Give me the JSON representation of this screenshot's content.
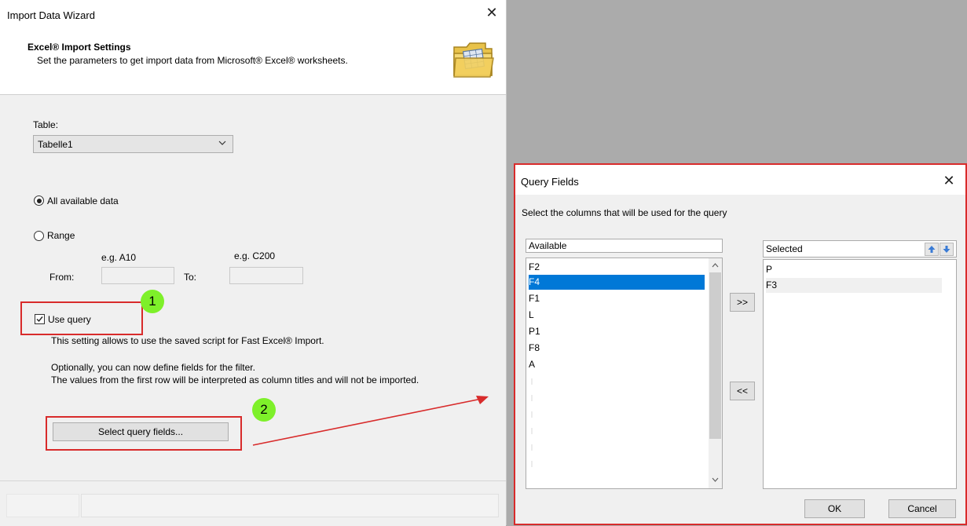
{
  "wizard": {
    "title": "Import Data Wizard",
    "close_glyph": "✕",
    "heading": "Excel® Import Settings",
    "subheading": "Set the parameters to get import data from Microsoft® Excel® worksheets.",
    "header_icon": "folder-spreadsheet-icon",
    "table_label": "Table:",
    "table_value": "Tabelle1",
    "option_all": "All available data",
    "option_range": "Range",
    "range_from_hint": "e.g. A10",
    "range_to_hint": "e.g. C200",
    "range_from_label": "From:",
    "range_to_label": "To:",
    "use_query_label": "Use query",
    "use_query_checked": true,
    "use_query_desc": "This setting allows to use the saved script for Fast Excel® Import.",
    "optional_line1": "Optionally, you can now define fields for the filter.",
    "optional_line2": "The values from the first row will be interpreted as column titles and will not be imported.",
    "select_fields_button": "Select query fields...",
    "selected_option": "All available data"
  },
  "annotations": {
    "badge1": "1",
    "badge2": "2",
    "highlight_color": "#d82b2b",
    "badge_color": "#7ef02a"
  },
  "query_fields": {
    "title": "Query Fields",
    "close_glyph": "✕",
    "description": "Select the columns that will be used for the query",
    "available_header": "Available",
    "selected_header": "Selected",
    "available_items": [
      "F2",
      "F4",
      "F1",
      "L",
      "P1",
      "F8",
      "A"
    ],
    "available_selected": "F4",
    "selected_items": [
      "P",
      "F3"
    ],
    "add_button": ">>",
    "remove_button": "<<",
    "move_up_icon": "arrow-up-icon",
    "move_down_icon": "arrow-down-icon",
    "ok_button": "OK",
    "cancel_button": "Cancel",
    "selection_color": "#0078d7"
  }
}
